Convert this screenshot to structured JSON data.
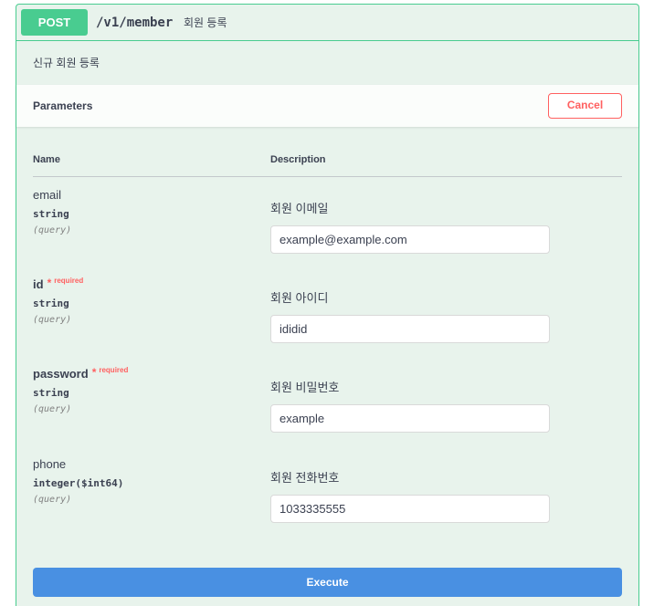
{
  "operation": {
    "method": "POST",
    "path": "/v1/member",
    "summary": "회원 등록",
    "description": "신규 회원 등록"
  },
  "parameters_section": {
    "title": "Parameters",
    "cancel_label": "Cancel",
    "column_name": "Name",
    "column_description": "Description"
  },
  "params": [
    {
      "name": "email",
      "required": false,
      "type": "string",
      "in": "(query)",
      "description": "회원 이메일",
      "value": "example@example.com"
    },
    {
      "name": "id",
      "required": true,
      "required_label": "required",
      "type": "string",
      "in": "(query)",
      "description": "회원 아이디",
      "value": "ididid"
    },
    {
      "name": "password",
      "required": true,
      "required_label": "required",
      "type": "string",
      "in": "(query)",
      "description": "회원 비밀번호",
      "value": "example"
    },
    {
      "name": "phone",
      "required": false,
      "type": "integer($int64)",
      "in": "(query)",
      "description": "회원 전화번호",
      "value": "1033335555"
    }
  ],
  "execute_label": "Execute",
  "colors": {
    "post": "#49cc90",
    "cancel": "#ff6060",
    "execute": "#4990e2",
    "block_bg": "#e8f3ec"
  }
}
